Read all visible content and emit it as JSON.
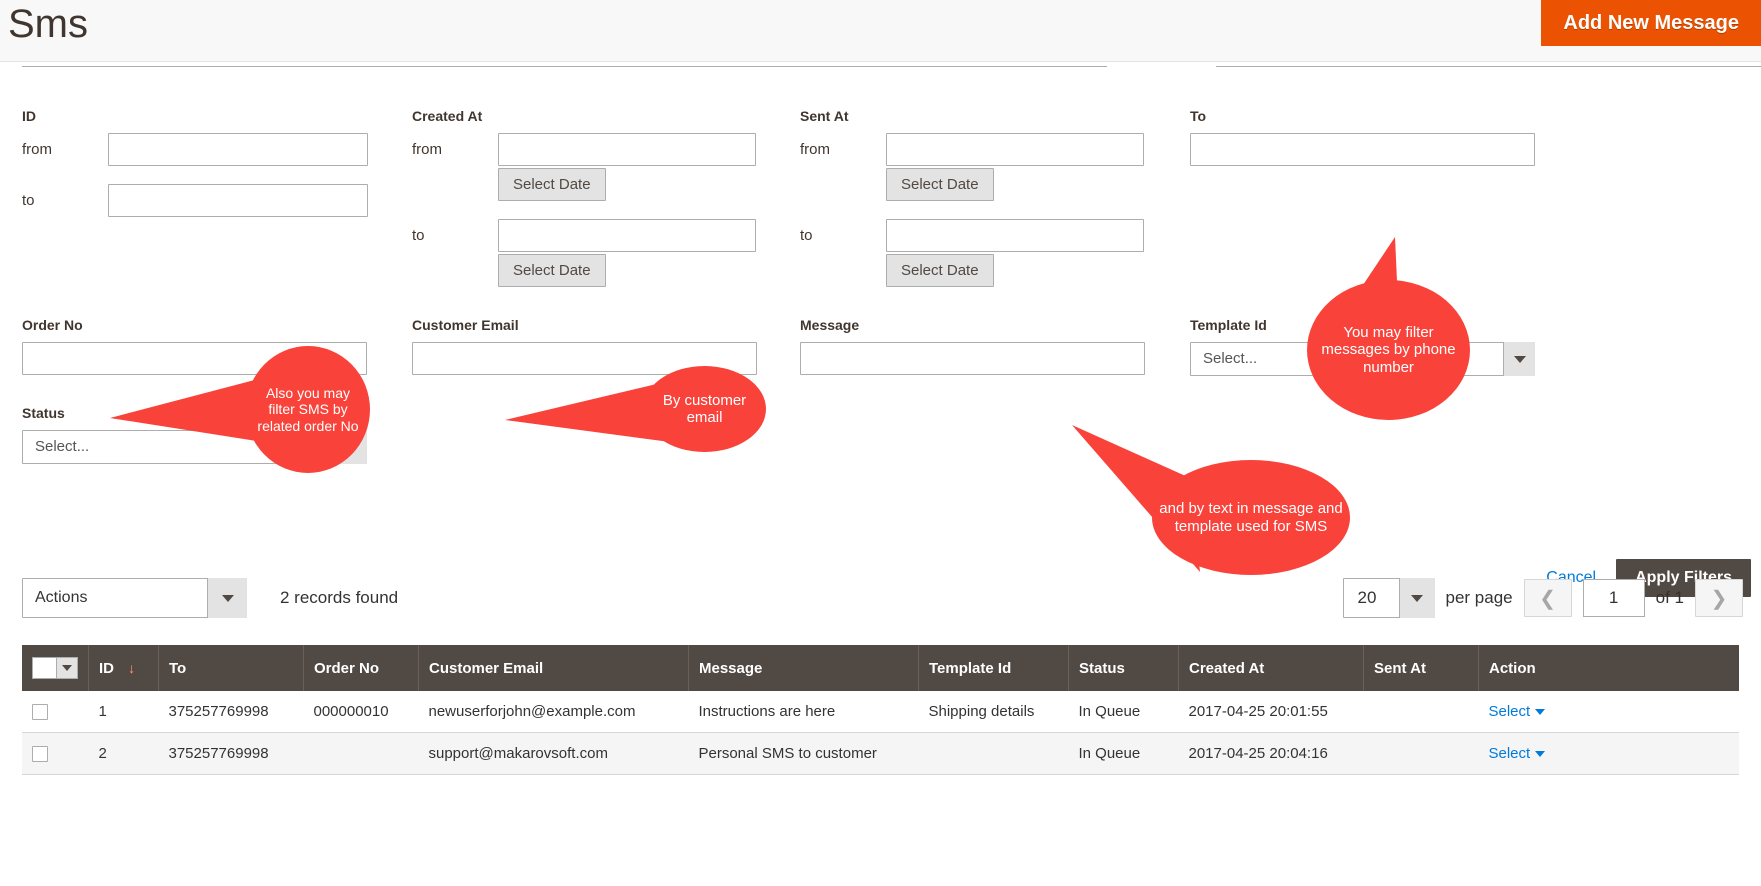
{
  "header": {
    "title": "Sms",
    "add_button": "Add New Message"
  },
  "filters": {
    "id": {
      "label": "ID",
      "from_label": "from",
      "to_label": "to",
      "from_value": "",
      "to_value": ""
    },
    "created_at": {
      "label": "Created At",
      "from_label": "from",
      "to_label": "to",
      "from_value": "",
      "to_value": "",
      "select_date": "Select Date"
    },
    "sent_at": {
      "label": "Sent At",
      "from_label": "from",
      "to_label": "to",
      "from_value": "",
      "to_value": "",
      "select_date": "Select Date"
    },
    "to": {
      "label": "To",
      "value": ""
    },
    "order_no": {
      "label": "Order No",
      "value": ""
    },
    "customer_email": {
      "label": "Customer Email",
      "value": ""
    },
    "message": {
      "label": "Message",
      "value": ""
    },
    "template_id": {
      "label": "Template Id",
      "selected": "Select..."
    },
    "status": {
      "label": "Status",
      "selected": "Select..."
    },
    "cancel": "Cancel",
    "apply": "Apply Filters"
  },
  "toolbar": {
    "actions_selected": "Actions",
    "records_found": "2 records found",
    "per_page_value": "20",
    "per_page_label": "per page",
    "page_value": "1",
    "of_label": "of 1",
    "prev_icon": "chevron-left-icon",
    "next_icon": "chevron-right-icon"
  },
  "grid": {
    "columns": [
      "ID",
      "To",
      "Order No",
      "Customer Email",
      "Message",
      "Template Id",
      "Status",
      "Created At",
      "Sent At",
      "Action"
    ],
    "sort_indicator": "↓",
    "rows": [
      {
        "id": "1",
        "to": "375257769998",
        "order_no": "000000010",
        "customer_email": "newuserforjohn@example.com",
        "message": "Instructions are here",
        "template_id": "Shipping details",
        "status": "In Queue",
        "created_at": "2017-04-25 20:01:55",
        "sent_at": "",
        "action": "Select"
      },
      {
        "id": "2",
        "to": "375257769998",
        "order_no": "",
        "customer_email": "support@makarovsoft.com",
        "message": "Personal SMS to customer",
        "template_id": "",
        "status": "In Queue",
        "created_at": "2017-04-25 20:04:16",
        "sent_at": "",
        "action": "Select"
      }
    ]
  },
  "callouts": {
    "phone": "You may filter messages by phone number",
    "order": "Also you may filter SMS by related order No",
    "email": "By customer email",
    "message": "and by text in message and template used for SMS"
  },
  "colors": {
    "accent_orange": "#eb5202",
    "callout_red": "#f9423a",
    "grid_header": "#514943",
    "link_blue": "#007bdb"
  }
}
